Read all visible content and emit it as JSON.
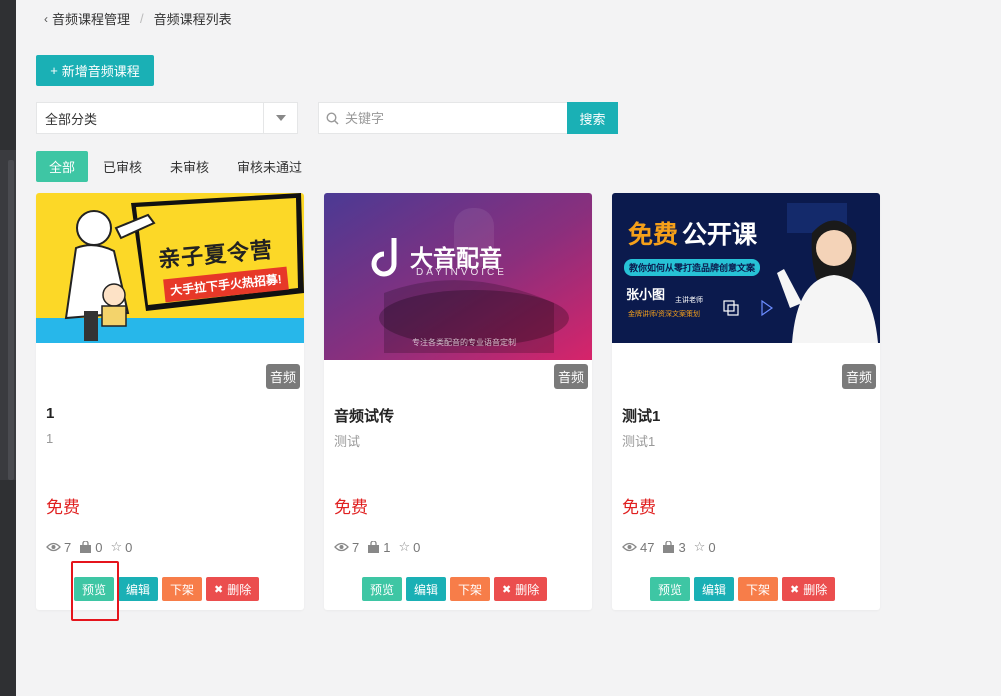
{
  "breadcrumb": {
    "parent": "音频课程管理",
    "current": "音频课程列表"
  },
  "toolbar": {
    "add_label": "新增音频课程"
  },
  "filter": {
    "category": "全部分类",
    "search_placeholder": "关键字",
    "search_label": "搜索"
  },
  "tabs": [
    {
      "label": "全部",
      "active": true
    },
    {
      "label": "已审核",
      "active": false
    },
    {
      "label": "未审核",
      "active": false
    },
    {
      "label": "审核未通过",
      "active": false
    }
  ],
  "cards": [
    {
      "image_text": {
        "line1": "亲子夏令营",
        "line2": "大手拉下手火热招募!"
      },
      "badge": "音频",
      "title": "1",
      "subtitle": "1",
      "price": "免费",
      "views": "7",
      "buys": "0",
      "stars": "0",
      "actions": {
        "preview": "预览",
        "edit": "编辑",
        "offline": "下架",
        "delete": "删除"
      }
    },
    {
      "image_text": {
        "line1": "大音配音",
        "line2": "DAYINVOICE",
        "line3": "专注各类配音的专业语音定制"
      },
      "badge": "音频",
      "title": "音频试传",
      "subtitle": "测试",
      "price": "免费",
      "views": "7",
      "buys": "1",
      "stars": "0",
      "actions": {
        "preview": "预览",
        "edit": "编辑",
        "offline": "下架",
        "delete": "删除"
      }
    },
    {
      "image_text": {
        "line1a": "免费",
        "line1b": "公开课",
        "line2": "教你如何从零打造品牌创意文案",
        "name": "张小图",
        "role": "主讲老师",
        "line3": "金牌讲师/资深文案策划"
      },
      "badge": "音频",
      "title": "测试1",
      "subtitle": "测试1",
      "price": "免费",
      "views": "47",
      "buys": "3",
      "stars": "0",
      "actions": {
        "preview": "预览",
        "edit": "编辑",
        "offline": "下架",
        "delete": "删除"
      }
    }
  ],
  "colors": {
    "primary": "#1ab0b5",
    "success": "#3ec6a4",
    "warning": "#f77d49",
    "danger": "#eb4e4e",
    "price": "#e02020",
    "highlight": "#e5141c"
  }
}
